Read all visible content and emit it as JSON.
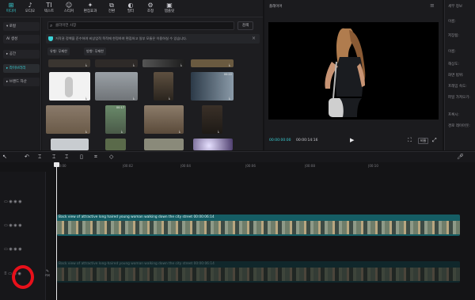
{
  "toolbar": {
    "items": [
      {
        "label": "미디어",
        "icon": "media-icon",
        "glyph": "⊞"
      },
      {
        "label": "오디오",
        "icon": "audio-icon",
        "glyph": "♪"
      },
      {
        "label": "텍스트",
        "icon": "text-icon",
        "glyph": "TI"
      },
      {
        "label": "스티커",
        "icon": "sticker-icon",
        "glyph": "☺"
      },
      {
        "label": "편집효과",
        "icon": "effects-icon",
        "glyph": "✦"
      },
      {
        "label": "전환",
        "icon": "transition-icon",
        "glyph": "⧉"
      },
      {
        "label": "필터",
        "icon": "filter-icon",
        "glyph": "◐"
      },
      {
        "label": "조정",
        "icon": "adjust-icon",
        "glyph": "⚙"
      },
      {
        "label": "템플릿",
        "icon": "template-icon",
        "glyph": "▣"
      }
    ]
  },
  "leftnav": {
    "items": [
      {
        "label": "▾ 로컬"
      },
      {
        "label": "AI 생성"
      },
      {
        "label": "▸ 공간"
      },
      {
        "label": "▸ 라이브러리"
      },
      {
        "label": "▸ 브랜드 자산"
      }
    ]
  },
  "media": {
    "search_placeholder": "클라이언 사장",
    "search_button": "검색",
    "notice": "저작권 정책을 준수하여 비상업적 목적에 한정하여 편집하고 일부 모듈은 이용하실 수 있습니다.",
    "filters": [
      "유형: 무제한",
      "방향: 무제한"
    ],
    "durations": [
      "00:17",
      "00:22"
    ]
  },
  "player": {
    "title": "플레이어",
    "current_time": "00:00:00:00",
    "total_time": "00:00:14:16",
    "ratio_label": "비율"
  },
  "details": {
    "header": "세부 정보",
    "labels": [
      "이름:",
      "저장됨:",
      "이름:",
      "해상도:",
      "화면 범위:",
      "프레임 속도:",
      "파일 가져오기:",
      "프록시:",
      "경로 레이아웃:"
    ]
  },
  "ruler": {
    "ticks": [
      "00:00",
      "|00:02",
      "|00:04",
      "|00:06",
      "|00:08",
      "|00:10"
    ]
  },
  "timeline": {
    "clip_title": "Back view of attractive long haired young woman walking down the city street",
    "clip_duration": "00:00:06:14",
    "clip_title_bottom": "Back view of attractive long-haired young woman walking down the city street  00:00:06:14",
    "cover_label": "커버"
  }
}
